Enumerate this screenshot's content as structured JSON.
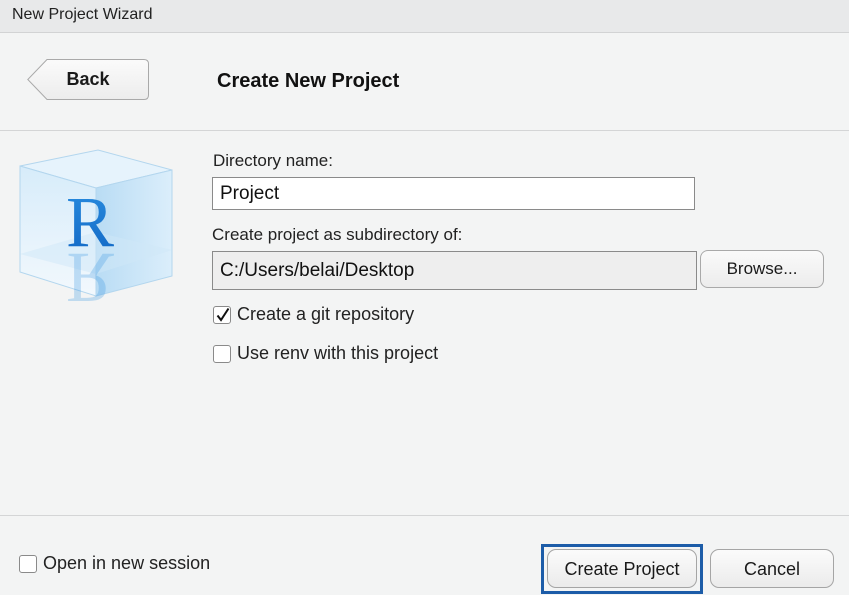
{
  "window": {
    "title": "New Project Wizard"
  },
  "header": {
    "back_label": "Back",
    "title": "Create New Project"
  },
  "form": {
    "directory_name": {
      "label": "Directory name:",
      "value": "Project"
    },
    "subdirectory": {
      "label": "Create project as subdirectory of:",
      "value": "C:/Users/belai/Desktop",
      "browse_label": "Browse..."
    },
    "git_repo": {
      "label": "Create a git repository",
      "checked": true
    },
    "renv": {
      "label": "Use renv with this project",
      "checked": false
    }
  },
  "footer": {
    "new_session": {
      "label": "Open in new session",
      "checked": false
    },
    "create_label": "Create Project",
    "cancel_label": "Cancel"
  },
  "logo": {
    "letter": "R",
    "accent": "#1f7fd6"
  }
}
